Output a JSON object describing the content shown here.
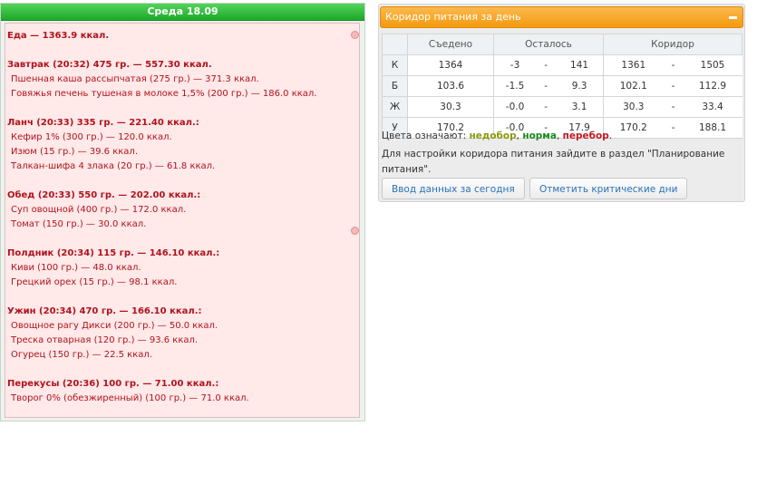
{
  "diary": {
    "header": "Среда 18.09",
    "total": "Еда — 1363.9 ккал.",
    "meals": [
      {
        "title": "Завтрак (20:32) 475 гр. — 557.30 ккал.",
        "items": [
          "Пшенная каша рассыпчатая (275 гр.) — 371.3 ккал.",
          "Говяжья печень тушеная в молоке 1,5% (200 гр.) — 186.0 ккал."
        ]
      },
      {
        "title": "Ланч (20:33) 335 гр. — 221.40 ккал.:",
        "items": [
          "Кефир 1% (300 гр.) — 120.0 ккал.",
          "Изюм (15 гр.) — 39.6 ккал.",
          "Талкан-шифа 4 злака (20 гр.) — 61.8 ккал."
        ]
      },
      {
        "title": "Обед (20:33) 550 гр. — 202.00 ккал.:",
        "items": [
          "Суп овощной (400 гр.) — 172.0 ккал.",
          "Томат (150 гр.) — 30.0 ккал."
        ]
      },
      {
        "title": "Полдник (20:34) 115 гр. — 146.10 ккал.:",
        "items": [
          "Киви (100 гр.) — 48.0 ккал.",
          "Грецкий орех (15 гр.) — 98.1 ккал."
        ]
      },
      {
        "title": "Ужин (20:34) 470 гр. — 166.10 ккал.:",
        "items": [
          "Овощное рагу Дикси (200 гр.) — 50.0 ккал.",
          "Треска отварная (120 гр.) — 93.6 ккал.",
          "Огурец (150 гр.) — 22.5 ккал."
        ]
      },
      {
        "title": "Перекусы (20:36) 100 гр. — 71.00 ккал.:",
        "items": [
          "Творог 0% (обезжиренный) (100 гр.) — 71.0 ккал."
        ]
      }
    ]
  },
  "corridor": {
    "header": "Коридор питания за день",
    "columns": [
      "",
      "Съедено",
      "Осталось",
      "Коридор"
    ],
    "rows": [
      {
        "label": "К",
        "eaten": "1364",
        "left_min": "-3",
        "left_max": "141",
        "cor_min": "1361",
        "cor_max": "1505"
      },
      {
        "label": "Б",
        "eaten": "103.6",
        "left_min": "-1.5",
        "left_max": "9.3",
        "cor_min": "102.1",
        "cor_max": "112.9"
      },
      {
        "label": "Ж",
        "eaten": "30.3",
        "left_min": "-0.0",
        "left_max": "3.1",
        "cor_min": "30.3",
        "cor_max": "33.4"
      },
      {
        "label": "У",
        "eaten": "170.2",
        "left_min": "-0.0",
        "left_max": "17.9",
        "cor_min": "170.2",
        "cor_max": "188.1"
      }
    ],
    "dash": "-",
    "legend_prefix": "Цвета означают:",
    "legend_under": "недобор",
    "legend_norm": "норма",
    "legend_over": "перебор",
    "comma": ",",
    "period": ".",
    "hint": "Для настройки коридора питания зайдите в раздел \"Планирование питания\".",
    "btn_today": "Ввод данных за сегодня",
    "btn_critical": "Отметить критические дни"
  },
  "colors": {
    "header_green": "#1ea82a",
    "header_orange": "#f39a0f",
    "diary_text": "#b0131d",
    "eaten_green": "#19891f"
  }
}
